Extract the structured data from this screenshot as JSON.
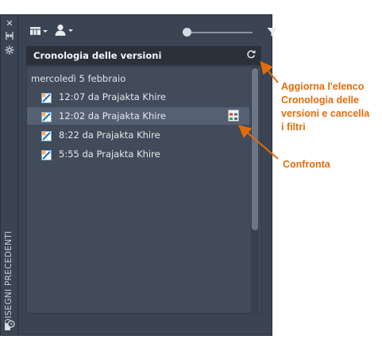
{
  "palette": {
    "side_label": "DISEGNI PRECEDENTI",
    "side_icons": [
      "close-icon",
      "autohide-icon",
      "settings-icon"
    ],
    "header_title": "Cronologia delle versioni",
    "date_group": "mercoledì 5 febbraio",
    "versions": [
      {
        "label": "12:07 da Prajakta Khire",
        "selected": false
      },
      {
        "label": "12:02 da Prajakta Khire",
        "selected": true
      },
      {
        "label": "8:22 da Prajakta Khire",
        "selected": false
      },
      {
        "label": "5:55 da Prajakta Khire",
        "selected": false
      }
    ]
  },
  "annotations": {
    "refresh_callout": [
      "Aggiorna l'elenco",
      "Cronologia delle",
      "versioni e cancella",
      "i filtri"
    ],
    "compare_callout": "Confronta"
  },
  "colors": {
    "accent_annotation": "#e36c0a",
    "panel_bg": "#3b4453",
    "header_bg": "#2b313b"
  }
}
